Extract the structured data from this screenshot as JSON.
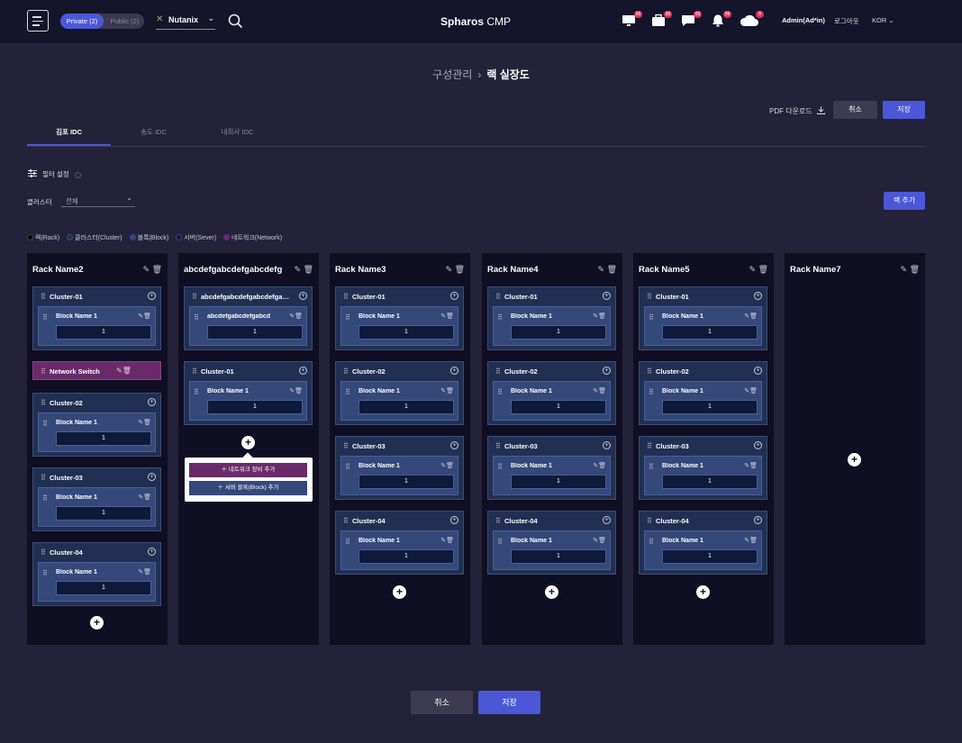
{
  "header": {
    "toggle": {
      "private": "Private (2)",
      "public": "Public (2)"
    },
    "provider": "Nutanix",
    "brand_bold": "Spharos",
    "brand_light": "CMP",
    "badges": {
      "monitor": "99",
      "briefcase": "99",
      "chat": "99",
      "bell": "99",
      "cloud": "9"
    },
    "admin": "Admin(Ad*in)",
    "logout": "로그아웃",
    "lang": "KOR"
  },
  "breadcrumb": {
    "parent": "구성관리",
    "current": "랙 실장도"
  },
  "actions": {
    "pdf": "PDF 다운로드",
    "cancel": "취소",
    "save": "저장"
  },
  "tabs": [
    "김포 IDC",
    "송도 IDC",
    "내회사 IDC"
  ],
  "filter": {
    "label": "필터 설정",
    "cluster_label": "클러스터",
    "cluster_value": "전체",
    "add_rack": "랙 추가"
  },
  "legend": [
    {
      "label": "랙(Rack)",
      "color": "#000000"
    },
    {
      "label": "클러스터(Cluster)",
      "color": "#213052"
    },
    {
      "label": "블록(Block)",
      "color": "#34487a"
    },
    {
      "label": "서버(Sever)",
      "color": "#0f1a3a"
    },
    {
      "label": "네트워크(Network)",
      "color": "#6a2a6a"
    }
  ],
  "racks": [
    {
      "name": "Rack Name2",
      "clusters": [
        {
          "name": "Cluster-01",
          "block": "Block Name 1",
          "value": "1"
        },
        {
          "name": "Cluster-02",
          "block": "Block Name 1",
          "value": "1"
        },
        {
          "name": "Cluster-03",
          "block": "Block Name 1",
          "value": "1"
        },
        {
          "name": "Cluster-04",
          "block": "Block Name 1",
          "value": "1"
        }
      ],
      "network": "Network Switch"
    },
    {
      "name": "abcdefgabcdefgabcdefg",
      "clusters": [
        {
          "name": "abcdefgabcdefgabcdefgabcdefg",
          "block": "abcdefgabcdefgabcd",
          "value": "1"
        },
        {
          "name": "Cluster-01",
          "block": "Block Name 1",
          "value": "1"
        }
      ]
    },
    {
      "name": "Rack Name3",
      "clusters": [
        {
          "name": "Cluster-01",
          "block": "Block Name 1",
          "value": "1"
        },
        {
          "name": "Cluster-02",
          "block": "Block Name 1",
          "value": "1"
        },
        {
          "name": "Cluster-03",
          "block": "Block Name 1",
          "value": "1"
        },
        {
          "name": "Cluster-04",
          "block": "Block Name 1",
          "value": "1"
        }
      ]
    },
    {
      "name": "Rack Name4",
      "clusters": [
        {
          "name": "Cluster-01",
          "block": "Block Name 1",
          "value": "1"
        },
        {
          "name": "Cluster-02",
          "block": "Block Name 1",
          "value": "1"
        },
        {
          "name": "Cluster-03",
          "block": "Block Name 1",
          "value": "1"
        },
        {
          "name": "Cluster-04",
          "block": "Block Name 1",
          "value": "1"
        }
      ]
    },
    {
      "name": "Rack Name5",
      "clusters": [
        {
          "name": "Cluster-01",
          "block": "Block Name 1",
          "value": "1"
        },
        {
          "name": "Cluster-02",
          "block": "Block Name 1",
          "value": "1"
        },
        {
          "name": "Cluster-03",
          "block": "Block Name 1",
          "value": "1"
        },
        {
          "name": "Cluster-04",
          "block": "Block Name 1",
          "value": "1"
        }
      ]
    },
    {
      "name": "Rack Name7",
      "clusters": []
    }
  ],
  "popup": {
    "network_add": "네트워크 장비 추가",
    "block_add": "서버 블록(Block) 추가"
  },
  "footer": {
    "cancel": "취소",
    "save": "저장"
  }
}
